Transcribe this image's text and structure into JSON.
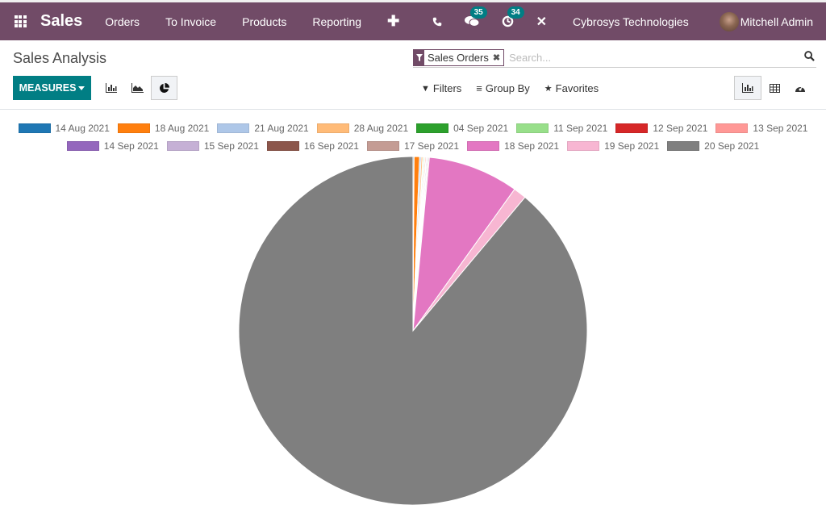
{
  "navbar": {
    "app_name": "Sales",
    "menu": [
      "Orders",
      "To Invoice",
      "Products",
      "Reporting"
    ],
    "messages_count": "35",
    "activities_count": "34",
    "company": "Cybrosys Technologies",
    "user": "Mitchell Admin"
  },
  "control_panel": {
    "title": "Sales Analysis",
    "measures_label": "MEASURES",
    "search": {
      "facet": "Sales Orders",
      "placeholder": "Search..."
    },
    "filters_label": "Filters",
    "groupby_label": "Group By",
    "favorites_label": "Favorites"
  },
  "chart_data": {
    "type": "pie",
    "title": "",
    "legend_position": "top",
    "categories": [
      "14 Aug 2021",
      "18 Aug 2021",
      "21 Aug 2021",
      "28 Aug 2021",
      "04 Sep 2021",
      "11 Sep 2021",
      "12 Sep 2021",
      "13 Sep 2021",
      "14 Sep 2021",
      "15 Sep 2021",
      "16 Sep 2021",
      "17 Sep 2021",
      "18 Sep 2021",
      "19 Sep 2021",
      "20 Sep 2021"
    ],
    "values": [
      0.1,
      0.5,
      0.15,
      0.15,
      0.05,
      0.1,
      0.05,
      0.1,
      0.05,
      0.1,
      0.05,
      0.1,
      8.4,
      1.2,
      88.8
    ],
    "value_unit": "percent (estimated)",
    "colors": [
      "#1f77b4",
      "#ff7f0e",
      "#aec7e8",
      "#ffbb78",
      "#2ca02c",
      "#98df8a",
      "#d62728",
      "#ff9896",
      "#9467bd",
      "#c5b0d5",
      "#8c564b",
      "#c49c94",
      "#e377c2",
      "#f7b6d2",
      "#7f7f7f"
    ]
  }
}
